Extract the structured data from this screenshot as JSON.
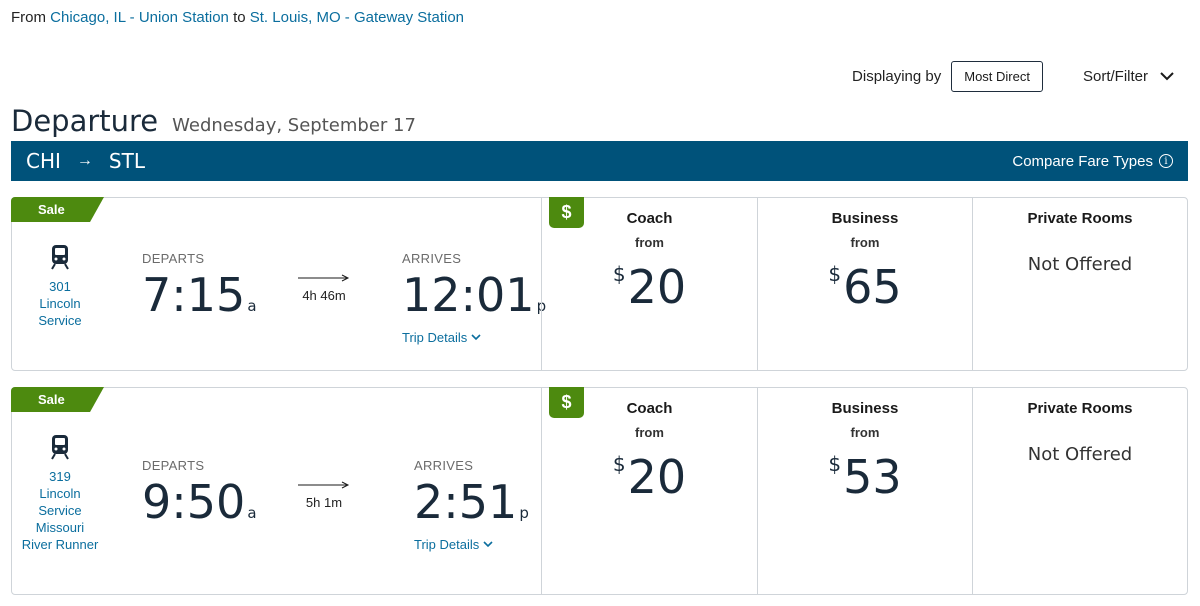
{
  "route_summary": {
    "from_label": "From",
    "origin": "Chicago, IL - Union Station",
    "to_label": "to",
    "destination": "St. Louis, MO - Gateway Station"
  },
  "display": {
    "label": "Displaying by",
    "sort_value": "Most Direct",
    "filter_label": "Sort/Filter"
  },
  "heading": {
    "title": "Departure",
    "date": "Wednesday, September 17"
  },
  "route_bar": {
    "origin_code": "CHI",
    "arrow": "→",
    "destination_code": "STL",
    "compare_label": "Compare Fare Types",
    "info_glyph": "i"
  },
  "colors": {
    "brand_blue": "#00527a",
    "link_blue": "#0b6e9e",
    "sale_green": "#4d8a0f"
  },
  "trips": [
    {
      "badge": "Sale",
      "train_lines": [
        "301",
        "Lincoln",
        "Service"
      ],
      "departs_label": "DEPARTS",
      "depart_time": "7:15",
      "depart_ampm": "a",
      "duration": "4h 46m",
      "arrives_label": "ARRIVES",
      "arrive_time": "12:01",
      "arrive_ampm": "p",
      "trip_details": "Trip Details",
      "fares": {
        "coach": {
          "title": "Coach",
          "from": "from",
          "currency": "$",
          "price": "20",
          "tag": "$"
        },
        "business": {
          "title": "Business",
          "from": "from",
          "currency": "$",
          "price": "65"
        },
        "rooms": {
          "title": "Private Rooms",
          "status": "Not Offered"
        }
      }
    },
    {
      "badge": "Sale",
      "train_lines": [
        "319",
        "Lincoln",
        "Service",
        "Missouri",
        "River Runner"
      ],
      "departs_label": "DEPARTS",
      "depart_time": "9:50",
      "depart_ampm": "a",
      "duration": "5h 1m",
      "arrives_label": "ARRIVES",
      "arrive_time": "2:51",
      "arrive_ampm": "p",
      "trip_details": "Trip Details",
      "fares": {
        "coach": {
          "title": "Coach",
          "from": "from",
          "currency": "$",
          "price": "20",
          "tag": "$"
        },
        "business": {
          "title": "Business",
          "from": "from",
          "currency": "$",
          "price": "53"
        },
        "rooms": {
          "title": "Private Rooms",
          "status": "Not Offered"
        }
      }
    }
  ]
}
